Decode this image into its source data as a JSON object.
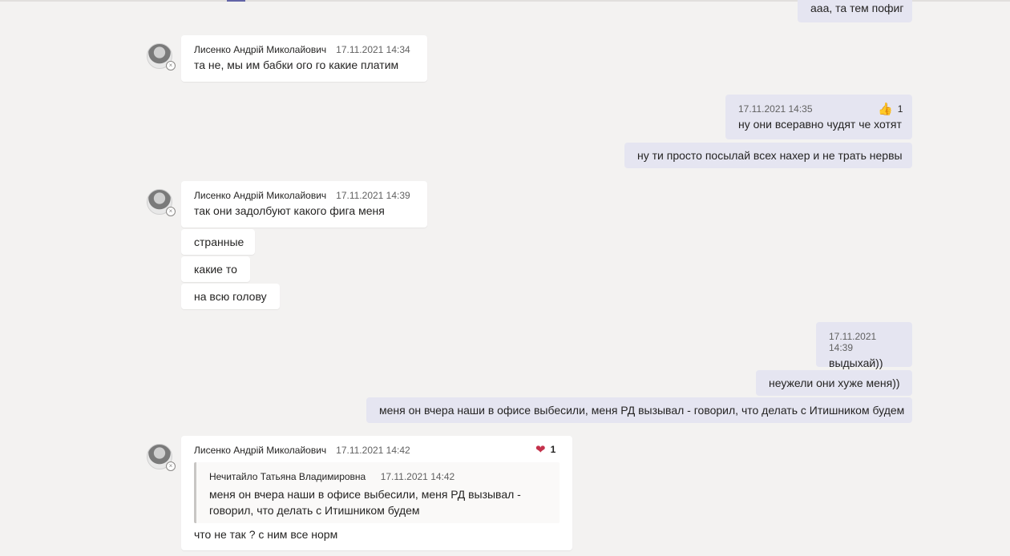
{
  "messages": {
    "m0": {
      "text": "ааа, та тем пофиг"
    },
    "m1": {
      "author": "Лисенко Андрій Миколайович",
      "time": "17.11.2021 14:34",
      "text": "та не, мы им бабки ого го какие платим"
    },
    "m2": {
      "time": "17.11.2021 14:35",
      "text": "ну они всеравно чудят че хотят",
      "reaction": {
        "icon": "👍",
        "count": "1"
      }
    },
    "m3": {
      "text": "ну ти просто посылай всех нахер и не трать нервы"
    },
    "m4": {
      "author": "Лисенко Андрій Миколайович",
      "time": "17.11.2021 14:39",
      "text": "так они задолбуют какого фига меня"
    },
    "m5": {
      "text": "странные"
    },
    "m6": {
      "text": "какие то"
    },
    "m7": {
      "text": "на всю голову"
    },
    "m8": {
      "time": "17.11.2021 14:39",
      "text": "выдыхай))"
    },
    "m9": {
      "text": "неужели они хуже меня))"
    },
    "m10": {
      "text": "меня он вчера наши в офисе выбесили, меня РД вызывал - говорил, что делать с Итишником будем"
    },
    "m11": {
      "author": "Лисенко Андрій Миколайович",
      "time": "17.11.2021 14:42",
      "reaction": {
        "icon": "❤",
        "count": "1"
      },
      "quote": {
        "author": "Нечитайло Татьяна Владимировна",
        "time": "17.11.2021 14:42",
        "line1": "меня он вчера наши в офисе выбесили, меня РД вызывал -",
        "line2": "говорил, что делать с Итишником будем"
      },
      "text": "что не так ? с ним все норм"
    }
  },
  "colors": {
    "background": "#f3f2f1",
    "outgoing": "#e5e5f1",
    "incoming": "#ffffff",
    "accent": "#6264a7",
    "heart": "#c4314b",
    "like": "#f2a93b"
  }
}
